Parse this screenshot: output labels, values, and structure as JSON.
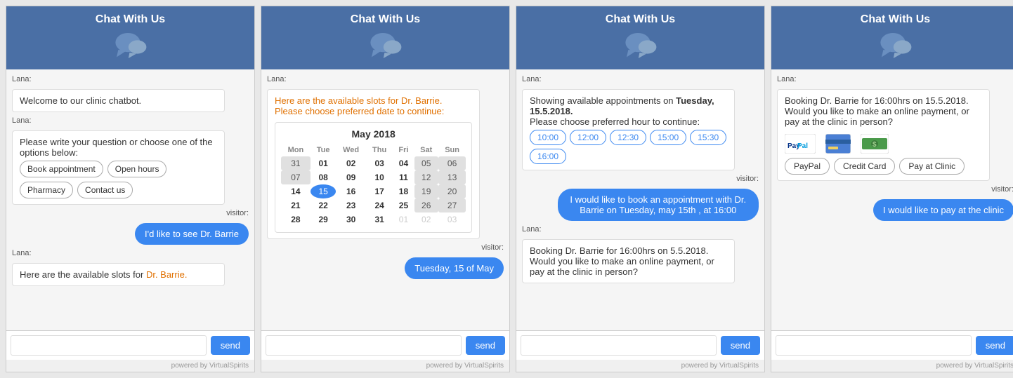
{
  "widgets": [
    {
      "id": "widget1",
      "header": "Chat With Us",
      "messages": [
        {
          "type": "lana",
          "text": "Welcome to our clinic chatbot."
        },
        {
          "type": "lana",
          "text": "Please write your question or choose one of the options below:"
        },
        {
          "type": "options",
          "items": [
            "Book appointment",
            "Open hours",
            "Pharmacy",
            "Contact us"
          ]
        },
        {
          "type": "visitor",
          "text": "I'd like to see Dr. Barrie"
        },
        {
          "type": "lana_partial",
          "text_before": "Here are the available slots for ",
          "highlight": "Dr. Barrie.",
          "text_after": ""
        }
      ],
      "send_label": "send",
      "powered_by": "powered by VirtualSpirits"
    },
    {
      "id": "widget2",
      "header": "Chat With Us",
      "messages": [
        {
          "type": "lana_orange",
          "text": "Here are the available slots for Dr. Barrie. Please choose preferred date to continue:"
        },
        {
          "type": "calendar",
          "month": "May 2018",
          "selected_day": 15
        },
        {
          "type": "visitor",
          "text": "Tuesday, 15 of May"
        }
      ],
      "send_label": "send",
      "powered_by": "powered by VirtualSpirits"
    },
    {
      "id": "widget3",
      "header": "Chat With Us",
      "messages": [
        {
          "type": "lana_showing",
          "text1": "Showing available appointments on ",
          "bold_text": "Tuesday, 15.5.2018.",
          "text2": "Please choose preferred hour to continue:"
        },
        {
          "type": "timeslots",
          "slots": [
            "10:00",
            "12:00",
            "12:30",
            "15:00",
            "15:30",
            "16:00"
          ]
        },
        {
          "type": "visitor",
          "text": "I would like to book an appointment with Dr. Barrie on Tuesday, may 15th , at 16:00"
        },
        {
          "type": "lana",
          "text": "Booking Dr. Barrie for 16:00hrs on 5.5.2018. Would you like to make an online payment, or pay at the clinic in person?"
        }
      ],
      "send_label": "send",
      "powered_by": "powered by VirtualSpirits"
    },
    {
      "id": "widget4",
      "header": "Chat With Us",
      "messages": [
        {
          "type": "lana_payment",
          "text": "Booking Dr. Barrie for 16:00hrs on 15.5.2018. Would you like to make an online payment, or pay at the clinic in person?"
        },
        {
          "type": "payment_options",
          "buttons": [
            "PayPal",
            "Credit Card",
            "Pay at Clinic"
          ]
        },
        {
          "type": "visitor",
          "text": "I would like to pay at the clinic"
        }
      ],
      "send_label": "send",
      "powered_by": "powered by VirtualSpirits"
    }
  ],
  "calendar": {
    "month_label": "May 2018",
    "days_header": [
      "Mon",
      "Tue",
      "Wed",
      "Thu",
      "Fri",
      "Sat",
      "Sun"
    ],
    "weeks": [
      [
        "31",
        "01",
        "02",
        "03",
        "04",
        "05",
        "06"
      ],
      [
        "07",
        "08",
        "09",
        "10",
        "11",
        "12",
        "13"
      ],
      [
        "14",
        "15",
        "16",
        "17",
        "18",
        "19",
        "20"
      ],
      [
        "21",
        "22",
        "23",
        "24",
        "25",
        "26",
        "27"
      ],
      [
        "28",
        "29",
        "30",
        "31",
        "01",
        "02",
        "03"
      ]
    ],
    "week1_disabled": [
      true,
      false,
      false,
      false,
      false,
      true,
      true
    ],
    "week2_disabled": [
      false,
      false,
      false,
      false,
      false,
      true,
      true
    ],
    "week3_disabled": [
      false,
      false,
      false,
      false,
      false,
      true,
      true
    ],
    "week4_disabled": [
      false,
      false,
      false,
      false,
      false,
      true,
      true
    ],
    "week5_disabled": [
      false,
      false,
      false,
      false,
      true,
      true,
      true
    ],
    "selected_cell": "15"
  },
  "icons": {
    "chat": "💬",
    "paypal_color": "#003087",
    "send_color": "#3a87f0"
  }
}
